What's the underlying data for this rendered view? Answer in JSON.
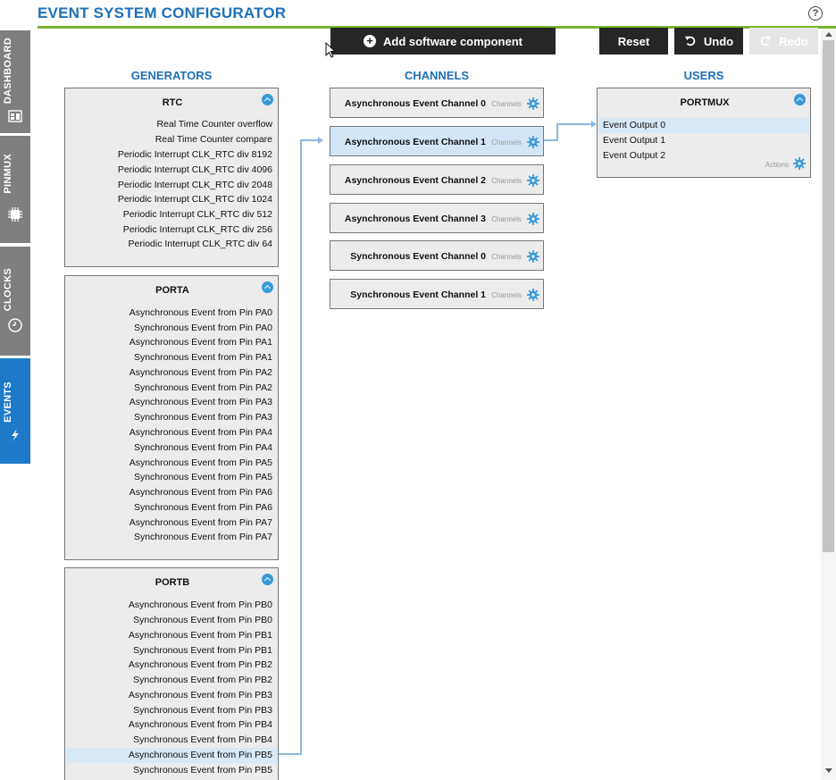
{
  "app": {
    "title": "EVENT SYSTEM CONFIGURATOR",
    "help_glyph": "?"
  },
  "sidebar": [
    {
      "label": "DASHBOARD",
      "icon": "dashboard-icon",
      "active": false
    },
    {
      "label": "PINMUX",
      "icon": "chip-icon",
      "active": false
    },
    {
      "label": "CLOCKS",
      "icon": "clock-icon",
      "active": false
    },
    {
      "label": "EVENTS",
      "icon": "lightning-icon",
      "active": true
    }
  ],
  "toolbar": {
    "add_label": "Add software component",
    "reset_label": "Reset",
    "undo_label": "Undo",
    "redo_label": "Redo"
  },
  "columns": {
    "generators": "GENERATORS",
    "channels": "CHANNELS",
    "users": "USERS"
  },
  "generators": [
    {
      "name": "RTC",
      "items": [
        "Real Time Counter overflow",
        "Real Time Counter compare",
        "Periodic Interrupt CLK_RTC div 8192",
        "Periodic Interrupt CLK_RTC div 4096",
        "Periodic Interrupt CLK_RTC div 2048",
        "Periodic Interrupt CLK_RTC div 1024",
        "Periodic Interrupt CLK_RTC div 512",
        "Periodic Interrupt CLK_RTC div 256",
        "Periodic Interrupt CLK_RTC div 64"
      ]
    },
    {
      "name": "PORTA",
      "items": [
        "Asynchronous Event from Pin PA0",
        "Synchronous Event from Pin PA0",
        "Asynchronous Event from Pin PA1",
        "Synchronous Event from Pin PA1",
        "Asynchronous Event from Pin PA2",
        "Synchronous Event from Pin PA2",
        "Asynchronous Event from Pin PA3",
        "Synchronous Event from Pin PA3",
        "Asynchronous Event from Pin PA4",
        "Synchronous Event from Pin PA4",
        "Asynchronous Event from Pin PA5",
        "Synchronous Event from Pin PA5",
        "Asynchronous Event from Pin PA6",
        "Synchronous Event from Pin PA6",
        "Asynchronous Event from Pin PA7",
        "Synchronous Event from Pin PA7"
      ]
    },
    {
      "name": "PORTB",
      "items": [
        "Asynchronous Event from Pin PB0",
        "Synchronous Event from Pin PB0",
        "Asynchronous Event from Pin PB1",
        "Synchronous Event from Pin PB1",
        "Asynchronous Event from Pin PB2",
        "Synchronous Event from Pin PB2",
        "Asynchronous Event from Pin PB3",
        "Synchronous Event from Pin PB3",
        "Asynchronous Event from Pin PB4",
        "Synchronous Event from Pin PB4",
        "Asynchronous Event from Pin PB5",
        "Synchronous Event from Pin PB5"
      ],
      "selected_item": "Asynchronous Event from Pin PB5"
    }
  ],
  "channels": [
    {
      "name": "Asynchronous Event Channel 0",
      "sub": "Channels"
    },
    {
      "name": "Asynchronous Event Channel 1",
      "sub": "Channels",
      "selected": true
    },
    {
      "name": "Asynchronous Event Channel 2",
      "sub": "Channels"
    },
    {
      "name": "Asynchronous Event Channel 3",
      "sub": "Channels"
    },
    {
      "name": "Synchronous Event Channel 0",
      "sub": "Channels"
    },
    {
      "name": "Synchronous Event Channel 1",
      "sub": "Channels"
    }
  ],
  "users": [
    {
      "name": "PORTMUX",
      "items": [
        "Event Output 0",
        "Event Output 1",
        "Event Output 2"
      ],
      "selected_item": "Event Output 0",
      "actions_label": "Actions"
    }
  ],
  "colors": {
    "accent": "#1e70b8",
    "rule": "#79b52f",
    "active_tab": "#1e7ac8",
    "tab": "#7f7f7f",
    "link_line": "#8db8e0"
  }
}
